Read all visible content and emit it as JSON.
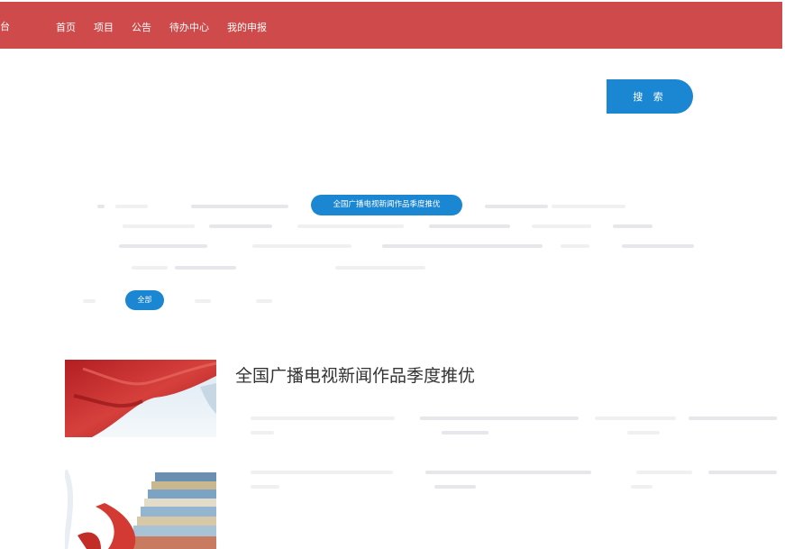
{
  "nav": {
    "logo_fragment": "台",
    "items": [
      "首页",
      "项目",
      "公告",
      "待办中心",
      "我的申报"
    ]
  },
  "search": {
    "button_label": "搜 索"
  },
  "filters": {
    "active_category": "全国广播电视新闻作品季度推优",
    "all_label": "全部"
  },
  "article": {
    "title": "全国广播电视新闻作品季度推优"
  },
  "colors": {
    "nav_bg": "#cf4a4a",
    "accent": "#1b86d1"
  }
}
